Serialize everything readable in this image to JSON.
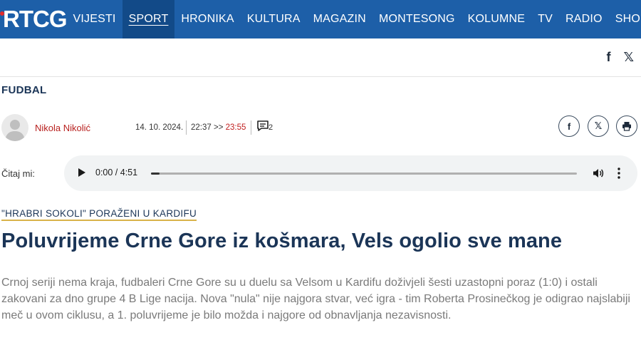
{
  "nav": {
    "logo": "RTCG",
    "items": [
      {
        "label": "VIJESTI",
        "active": false
      },
      {
        "label": "SPORT",
        "active": true
      },
      {
        "label": "HRONIKA",
        "active": false
      },
      {
        "label": "KULTURA",
        "active": false
      },
      {
        "label": "MAGAZIN",
        "active": false
      },
      {
        "label": "MONTESONG",
        "active": false
      },
      {
        "label": "KOLUMNE",
        "active": false
      },
      {
        "label": "TV",
        "active": false
      },
      {
        "label": "RADIO",
        "active": false
      },
      {
        "label": "SHO",
        "active": false
      }
    ]
  },
  "social_top": {
    "facebook": "f",
    "x": "𝕏"
  },
  "section": "FUDBAL",
  "meta": {
    "author": "Nikola Nikolić",
    "date": "14. 10. 2024.",
    "time": "22:37",
    "arrow": ">>",
    "updated": "23:55",
    "comments": "2"
  },
  "share": {
    "facebook": "f",
    "x": "𝕏",
    "print": "print"
  },
  "audio": {
    "label": "Čitaj mi:",
    "time": "0:00 / 4:51",
    "progress": 0.02
  },
  "article": {
    "kicker": "\"HRABRI SOKOLI\" PORAŽENI U KARDIFU",
    "headline": "Poluvrijeme Crne Gore iz košmara, Vels ogolio sve mane",
    "lead": "Crnoj seriji nema kraja, fudbaleri Crne Gore su u duelu sa Velsom u Kardifu doživjeli šesti uzastopni poraz (1:0) i ostali zakovani za dno grupe 4 B Lige nacija. Nova \"nula\" nije najgora stvar, već igra - tim Roberta Prosinečkog je odigrao najslabiji meč u ovom ciklusu, a 1. poluvrijeme je bilo možda i najgore od obnavljanja nezavisnosti."
  },
  "colors": {
    "nav_bg": "#1d5fa8",
    "nav_active": "#124a88",
    "author": "#b8201e",
    "headline": "#1b3557",
    "kicker_underline": "#d9b34a"
  }
}
